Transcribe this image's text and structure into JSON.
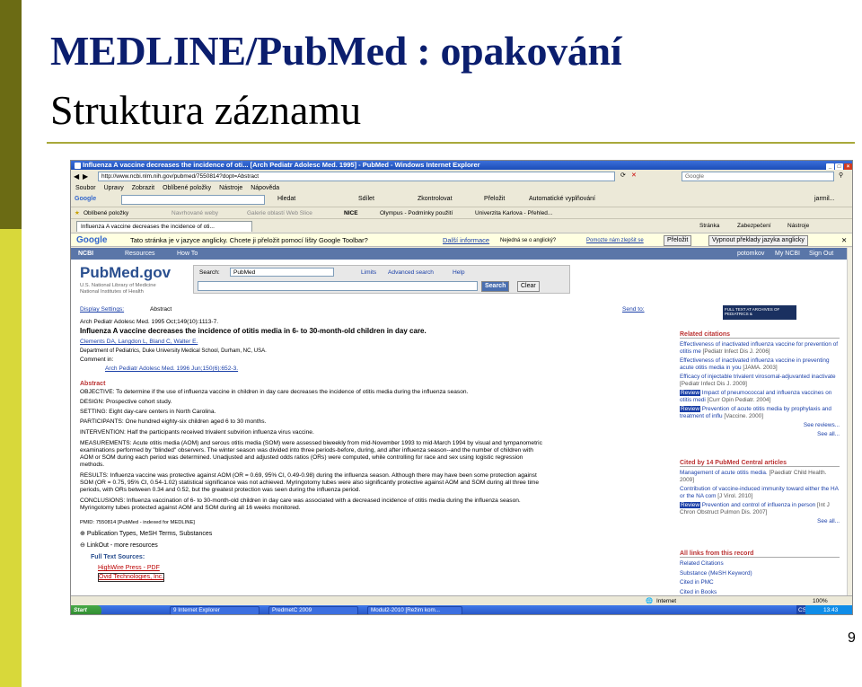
{
  "slide": {
    "title_line1": "MEDLINE/PubMed : opakování",
    "title_line2": "Struktura záznamu",
    "page_number": "9",
    "colors": {
      "title": "#0b1e6e",
      "bar_dark": "#6b6b14",
      "bar_light": "#d8d83a"
    }
  },
  "browser": {
    "window_title": "Influenza A vaccine decreases the incidence of oti... [Arch Pediatr Adolesc Med. 1995] - PubMed - Windows Internet Explorer",
    "address": "http://www.ncbi.nlm.nih.gov/pubmed/7550814?dopt=Abstract",
    "search_engine": "Google",
    "menu": [
      "Soubor",
      "Úpravy",
      "Zobrazit",
      "Oblíbené položky",
      "Nástroje",
      "Nápověda"
    ],
    "google_toolbar": {
      "logo": "Google",
      "search_btn": "Hledat",
      "share": "Sdílet",
      "translate": "Zkontrolovat",
      "translate2": "Přeložit",
      "autofill": "Automatické vyplňování",
      "user": "jarmil..."
    },
    "favorites": {
      "label": "Oblíbené položky",
      "items": [
        "Navrhované weby",
        "Galerie oblastí Web Slice",
        "NICE",
        "Olympus - Podmínky použití",
        "Univerzita Karlova - Přehled..."
      ]
    },
    "tab": "Influenza A vaccine decreases the incidence of oti...",
    "tab_tools": [
      "Stránka",
      "Zabezpečení",
      "Nástroje"
    ],
    "translate_bar": {
      "message": "Tato stránka je v jazyce anglicky. Chcete ji přeložit pomocí lišty Google Toolbar?",
      "more_info": "Další informace",
      "never": "Nejedná se o anglický?",
      "help": "Pomozte nám zlepšit se",
      "translate_btn": "Přeložit",
      "off_btn": "Vypnout překlady jazyka anglicky"
    },
    "status": {
      "zone": "Internet",
      "zoom": "100%"
    },
    "taskbar": {
      "start": "Start",
      "tasks": [
        "9 Internet Explorer",
        "PredmetC 2009",
        "Modul2-2010 [Režim kom..."
      ],
      "time": "13:43",
      "lang": "CS"
    }
  },
  "pubmed": {
    "ncbi": "NCBI",
    "resources": "Resources",
    "howto": "How To",
    "top_links": [
      "potomkov",
      "My NCBI",
      "Sign Out"
    ],
    "logo": "PubMed.gov",
    "logo_sub1": "U.S. National Library of Medicine",
    "logo_sub2": "National Institutes of Health",
    "search_label": "Search:",
    "search_db": "PubMed",
    "search_links": [
      "Limits",
      "Advanced search",
      "Help"
    ],
    "search_btn": "Search",
    "clear_btn": "Clear",
    "display_settings": "Display Settings:",
    "display_value": "Abstract",
    "send_to": "Send to:",
    "fulltext_badge": "FULL TEXT AT ARCHIVES OF PEDIATRICS &",
    "citation": "Arch Pediatr Adolesc Med. 1995 Oct;149(10):1113-7.",
    "article_title": "Influenza A vaccine decreases the incidence of otitis media in 6- to 30-month-old children in day care.",
    "authors": "Clements DA, Langdon L, Bland C, Walter E.",
    "affiliation": "Department of Pediatrics, Duke University Medical School, Durham, NC, USA.",
    "comment_label": "Comment in:",
    "comment_ref": "Arch Pediatr Adolesc Med. 1996 Jun;150(6):652-3.",
    "abstract_head": "Abstract",
    "abstract": [
      "OBJECTIVE: To determine if the use of influenza vaccine in children in day care decreases the incidence of otitis media during the influenza season.",
      "DESIGN: Prospective cohort study.",
      "SETTING: Eight day-care centers in North Carolina.",
      "PARTICIPANTS: One hundred eighty-six children aged 6 to 30 months.",
      "INTERVENTION: Half the participants received trivalent subvirion influenza virus vaccine.",
      "MEASUREMENTS: Acute otitis media (AOM) and serous otitis media (SOM) were assessed biweekly from mid-November 1993 to mid-March 1994 by visual and tympanometric",
      "examinations performed by \"blinded\" observers. The winter season was divided into three periods-before, during, and after influenza season--and the number of children with",
      "AOM or SOM during each period was determined. Unadjusted and adjusted odds ratios (ORs) were computed, while controlling for race and sex using logistic regression",
      "methods.",
      "RESULTS: Influenza vaccine was protective against AOM (OR = 0.69, 95% CI, 0.49-0.98) during the influenza season. Although there may have been some protection against",
      "SOM (OR = 0.75, 95% CI, 0.54-1.02) statistical significance was not achieved. Myringotomy tubes were also significantly protective against AOM and SOM during all three time",
      "periods, with ORs between 0.34 and 0.52, but the greatest protection was seen during the influenza period.",
      "CONCLUSIONS: Influenza vaccination of 6- to 30-month-old children in day care was associated with a decreased incidence of otitis media during the influenza season.",
      "Myringotomy tubes protected against AOM and SOM during all 16 weeks monitored."
    ],
    "pmid": "PMID: 7550814 [PubMed - indexed for MEDLINE]",
    "pub_types": "Publication Types, MeSH Terms, Substances",
    "linkout": "LinkOut - more resources",
    "fulltext_sources": "Full Text Sources:",
    "sources": [
      "HighWire Press - PDF",
      "Ovid Technologies, Inc."
    ],
    "related": {
      "head": "Related citations",
      "items": [
        {
          "t": "Effectiveness of inactivated influenza vaccine for prevention of otitis me",
          "s": "[Pediatr Infect Dis J. 2006]"
        },
        {
          "t": "Effectiveness of inactivated influenza vaccine in preventing acute otitis media in you",
          "s": "[JAMA. 2003]"
        },
        {
          "t": "Efficacy of injectable trivalent virosomal-adjuvanted inactivate",
          "s": "[Pediatr Infect Dis J. 2009]"
        },
        {
          "t": "Impact of pneumococcal and influenza vaccines on otitis medi",
          "s": "[Curr Opin Pediatr. 2004]"
        },
        {
          "t": "Prevention of acute otitis media by prophylaxis and treatment of influ",
          "s": "[Vaccine. 2000]"
        }
      ],
      "review": "Review",
      "more": "See reviews...",
      "all": "See all..."
    },
    "cited": {
      "head": "Cited by 14 PubMed Central articles",
      "items": [
        {
          "t": "Management of acute otitis media.",
          "s": "[Paediatr Child Health. 2009]"
        },
        {
          "t": "Contribution of vaccine-induced immunity toward either the HA or the NA com",
          "s": "[J Virol. 2010]"
        },
        {
          "t": "Prevention and control of influenza in person",
          "s": "[Int J Chron Obstruct Pulmon Dis. 2007]"
        }
      ],
      "all": "See all..."
    },
    "alllinks": {
      "head": "All links from this record",
      "items": [
        "Related Citations",
        "Substance (MeSH Keyword)",
        "Cited in PMC",
        "Cited in Books"
      ]
    }
  }
}
